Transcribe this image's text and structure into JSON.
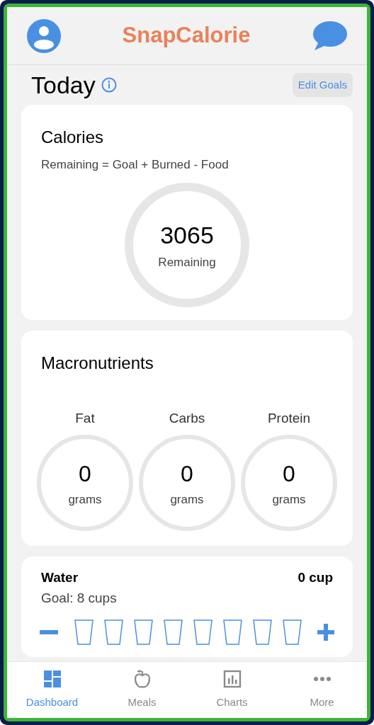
{
  "header": {
    "title": "SnapCalorie"
  },
  "today": {
    "title": "Today",
    "edit_button": "Edit Goals"
  },
  "calories": {
    "title": "Calories",
    "formula": "Remaining = Goal + Burned - Food",
    "value": "3065",
    "label": "Remaining"
  },
  "macros": {
    "title": "Macronutrients",
    "items": [
      {
        "name": "Fat",
        "value": "0",
        "unit": "grams"
      },
      {
        "name": "Carbs",
        "value": "0",
        "unit": "grams"
      },
      {
        "name": "Protein",
        "value": "0",
        "unit": "grams"
      }
    ]
  },
  "water": {
    "title": "Water",
    "amount": "0 cup",
    "goal": "Goal: 8 cups",
    "cups": [
      {
        "filled": false
      },
      {
        "filled": false
      },
      {
        "filled": false
      },
      {
        "filled": false
      },
      {
        "filled": false
      },
      {
        "filled": false
      },
      {
        "filled": false
      },
      {
        "filled": false
      }
    ]
  },
  "tabs": [
    {
      "label": "Dashboard",
      "kind": "dashboard",
      "selected": true
    },
    {
      "label": "Meals",
      "kind": "meals",
      "selected": false
    },
    {
      "label": "Charts",
      "kind": "charts",
      "selected": false
    },
    {
      "label": "More",
      "kind": "more",
      "selected": false
    }
  ]
}
